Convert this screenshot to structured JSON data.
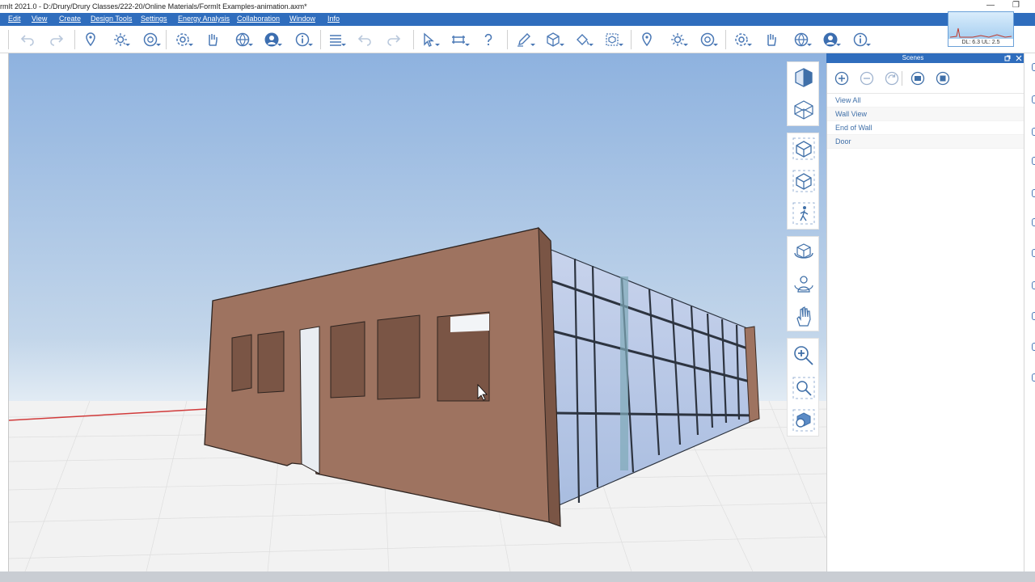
{
  "window": {
    "title": "rmIt 2021.0 - D:/Drury/Drury Classes/222-20/Online Materials/FormIt Examples-animation.axm*",
    "minimize_glyph": "—",
    "restore_glyph": "❐"
  },
  "menu": {
    "items": [
      "Edit",
      "View",
      "Create",
      "Design Tools",
      "Settings",
      "Energy Analysis",
      "Collaboration",
      "Window",
      "Info"
    ]
  },
  "toolbar": {
    "icons": [
      "undo-icon",
      "redo-icon",
      "location-icon",
      "sun-icon",
      "view-360-icon",
      "settings-gear-icon",
      "hand-gesture-icon",
      "globe-share-icon",
      "user-icon",
      "info-icon",
      "layers-list-icon",
      "undo-icon",
      "redo-icon",
      "select-arrow-icon",
      "dimension-icon",
      "help-question-icon",
      "draw-pencil-icon",
      "cube-icon",
      "paint-bucket-icon",
      "group-icon",
      "location-icon",
      "sun-icon",
      "view-360-icon",
      "settings-gear-icon",
      "hand-gesture-icon",
      "globe-share-icon",
      "user-icon",
      "info-icon"
    ]
  },
  "minimap": {
    "stats": "DL: 6.3  UL: 2.5"
  },
  "nav_panel": {
    "buttons": [
      "view-cube-front-icon",
      "view-cube-wire-icon",
      "perspective-cube-icon",
      "orthographic-cube-icon",
      "walk-person-icon",
      "orbit-cube-icon",
      "look-around-icon",
      "pan-hand-icon",
      "zoom-icon",
      "zoom-window-icon",
      "zoom-extents-icon"
    ]
  },
  "scenes": {
    "panel_title": "Scenes",
    "items": [
      {
        "label": "View All"
      },
      {
        "label": "Wall View"
      },
      {
        "label": "End of Wall"
      },
      {
        "label": "Door"
      }
    ]
  },
  "colors": {
    "menu_blue": "#2f6dbd",
    "icon_blue": "#4a78b5",
    "wall_brown": "#9e7360",
    "sky_top": "#8eb2df",
    "sky_bottom": "#eef4f8",
    "ground": "#f2f2f2",
    "axis_red": "#d13b3b",
    "glass": "#b8c8e6"
  }
}
